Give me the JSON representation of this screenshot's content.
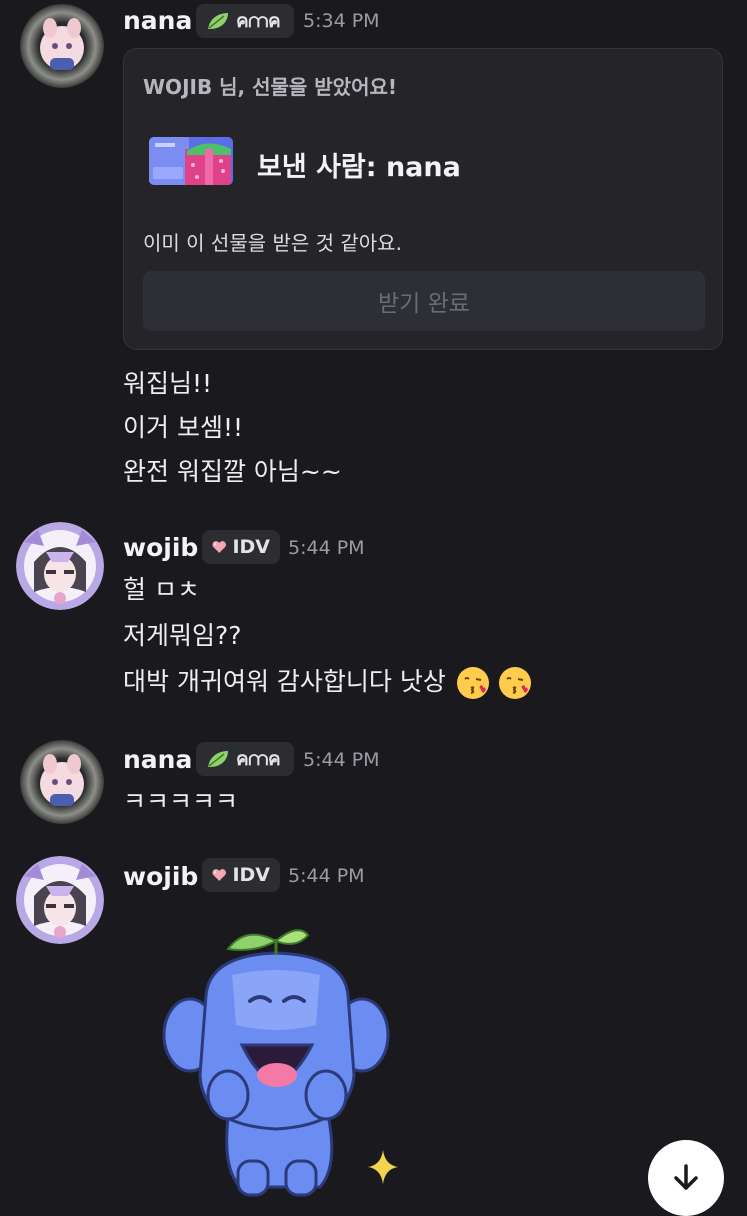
{
  "messages": [
    {
      "author": "nana",
      "tag_text": "ค⩋ค",
      "tag_icon": "leaf-icon",
      "time": "5:34 PM",
      "gift_card": {
        "title": "WOJIB 님, 선물을 받았어요!",
        "sender": "보낸 사람: nana",
        "status": "이미 이 선물을 받은 것 같아요.",
        "button": "받기 완료"
      },
      "lines": [
        "워집님!!",
        "이거 보셈!!",
        "완전 워집깔 아님~~"
      ]
    },
    {
      "author": "wojib",
      "tag_text": "IDV",
      "tag_icon": "heart-icon",
      "time": "5:44 PM",
      "lines": [
        "헐 ㅁㅊ",
        "저게뭐임??",
        "대박 개귀여워 감사합니다 낫상"
      ]
    },
    {
      "author": "nana",
      "tag_text": "ค⩋ค",
      "tag_icon": "leaf-icon",
      "time": "5:44 PM",
      "lines": [
        "ㅋㅋㅋㅋㅋ"
      ]
    },
    {
      "author": "wojib",
      "tag_text": "IDV",
      "tag_icon": "heart-icon",
      "time": "5:44 PM",
      "sticker": "wumpus-sticker"
    }
  ],
  "colors": {
    "background": "#1a1a1e",
    "card": "#242429",
    "accent_blue": "#6b8cf0",
    "leaf_green": "#8fd16a"
  }
}
